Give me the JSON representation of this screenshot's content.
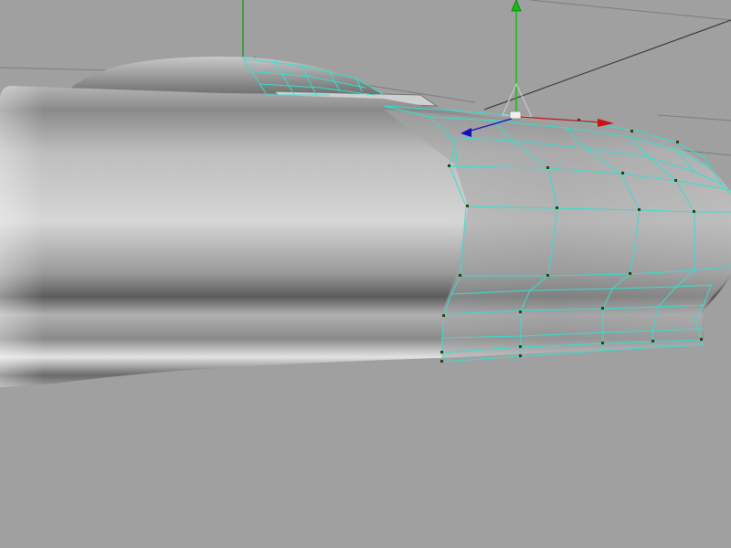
{
  "viewport": {
    "background_color": "#a0a0a0",
    "camera": "perspective",
    "shading": "smooth-shaded",
    "wireframe_on_selection": true
  },
  "model": {
    "surface_color": "#9a9a9a",
    "highlight_color": "#e8e8e8",
    "shadow_color": "#4a4a4a",
    "selection_wire_color": "#33e0d0",
    "vertex_color": "#3a3a10"
  },
  "manipulator": {
    "type": "move-tool",
    "x_axis_color": "#d01010",
    "y_axis_color": "#10c010",
    "z_axis_color": "#1010c0",
    "center_color": "#f0f0f0"
  },
  "grid": {
    "visible": true,
    "line_color": "#7c7c7c"
  }
}
